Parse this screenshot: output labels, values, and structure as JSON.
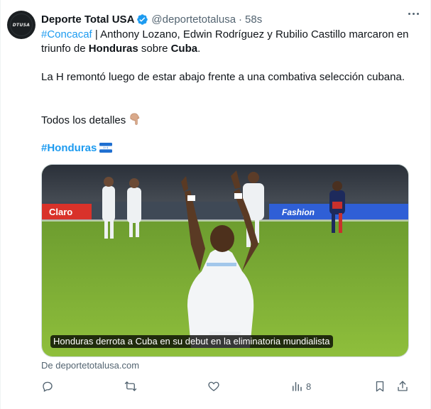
{
  "author": {
    "avatar_text": "DTUSA",
    "name": "Deporte Total USA",
    "handle": "@deportetotalusa",
    "separator": "·",
    "time": "58s"
  },
  "tweet": {
    "hashtag_concacaf": "#Concacaf",
    "line1_text_a": " | Anthony Lozano, Edwin Rodríguez y Rubilio Castillo marcaron en triunfo de ",
    "line1_bold_honduras": "Honduras",
    "line1_text_b": " sobre ",
    "line1_bold_cuba": "Cuba",
    "line1_text_c": ".",
    "paragraph2": "La H remontó luego de estar abajo frente a una combativa selección cubana.",
    "paragraph3": "Todos los detalles",
    "hashtag_honduras": "#Honduras"
  },
  "card": {
    "caption": "Honduras derrota a Cuba en su debut en la eliminatoria mundialista",
    "source": "De deportetotalusa.com",
    "board_text_1": "Claro",
    "board_text_2": "Fashion"
  },
  "actions": {
    "views_count": "8"
  },
  "colors": {
    "link": "#1d9bf0",
    "text_secondary": "#536471",
    "verified": "#1d9bf0"
  }
}
